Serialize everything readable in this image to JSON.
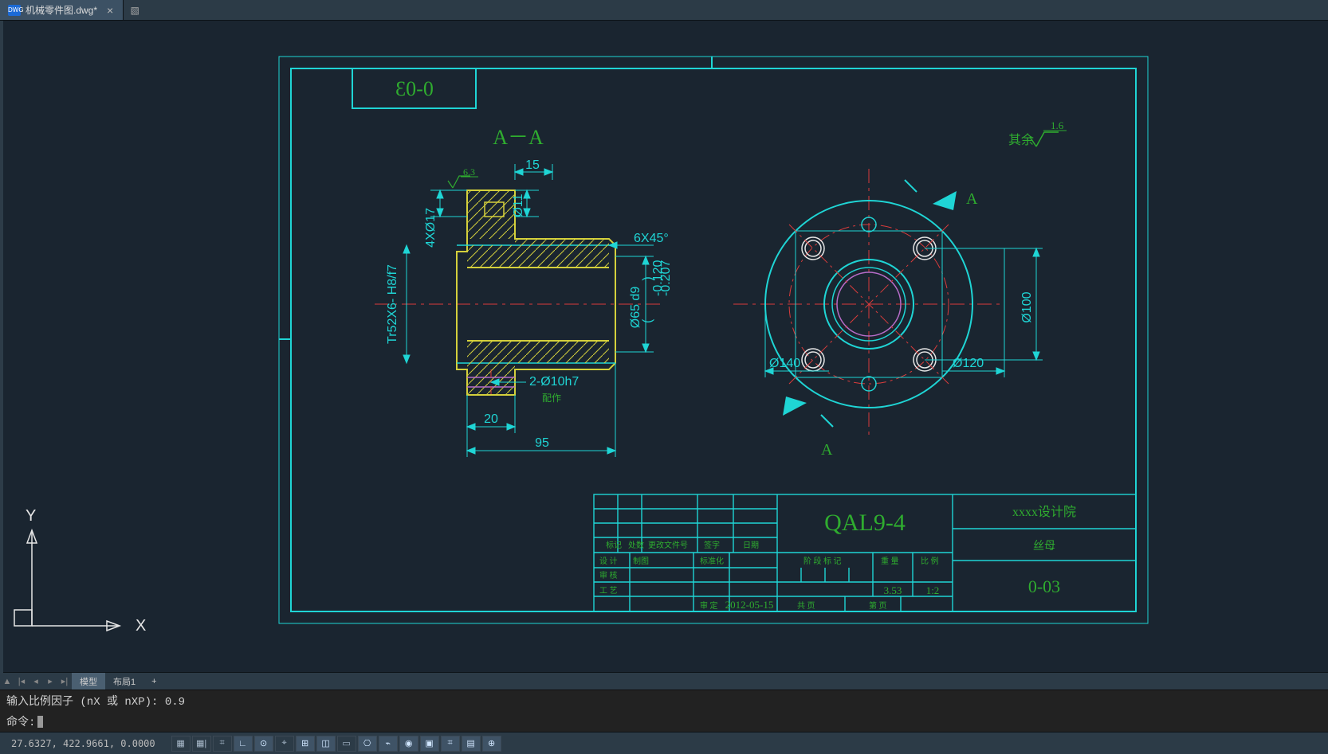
{
  "tab": {
    "filename": "机械零件图.dwg*",
    "close": "×",
    "new_icon": "+"
  },
  "drawing": {
    "part_no_corner": "0-03",
    "section_label": "A－A",
    "surface_note": "其余",
    "surface_value": "1.6",
    "section_marker": "A",
    "dims": {
      "holes_4x": "4XØ17",
      "ra63": "6.3",
      "d11": "Ø11",
      "w15": "15",
      "thread": "Tr52X6- H8/f7",
      "chamfer": "6X45°",
      "d65": "Ø65 d9",
      "tol_up": "-0.120",
      "tol_lo": "-0.207",
      "pin": "2-Ø10h7",
      "pin_note": "配作",
      "w20": "20",
      "w95": "95",
      "d140": "Ø140",
      "d100": "Ø100",
      "d120": "Ø120"
    },
    "title_block": {
      "material": "QAL9-4",
      "company": "xxxx设计院",
      "part_name": "丝母",
      "drawing_no": "0-03",
      "date": "2012-05-15",
      "weight": "3.53",
      "scale": "1:2",
      "hdr": {
        "mark": "标记",
        "place": "处数",
        "change": "更改文件号",
        "sign": "签字",
        "dateh": "日期",
        "design": "设 计",
        "std": "标准化",
        "stage": "阶 段 标 记",
        "weight": "重 量",
        "scale": "比 例",
        "review": "审 核",
        "craft": "工 艺",
        "approve": "审 定",
        "sheet": "共   页",
        "page": "第   页"
      }
    },
    "ucs": {
      "x": "X",
      "y": "Y"
    }
  },
  "layout_tabs": {
    "model": "模型",
    "layout1": "布局1",
    "plus": "+"
  },
  "command": {
    "history": "输入比例因子 (nX 或 nXP): 0.9",
    "prompt": "命令:"
  },
  "status": {
    "coords": "27.6327, 422.9661, 0.0000",
    "icons": [
      "▦",
      "▦|",
      "⌗",
      "∟",
      "⊙",
      "⌖",
      "⊞",
      "◫",
      "▭",
      "⎔",
      "⌁",
      "◉",
      "▣",
      "⌗",
      "▤",
      "⊕"
    ]
  }
}
